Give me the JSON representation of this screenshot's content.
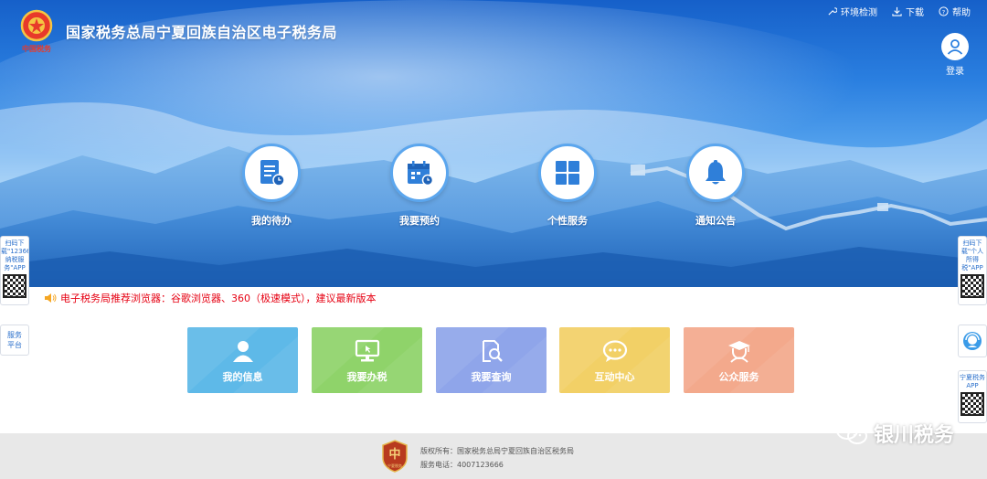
{
  "header": {
    "site_title": "国家税务总局宁夏回族自治区电子税务局",
    "logo_text": "中国税务",
    "top_links": [
      {
        "label": "环境检测",
        "icon": "wrench-icon"
      },
      {
        "label": "下载",
        "icon": "download-icon"
      },
      {
        "label": "帮助",
        "icon": "help-icon"
      }
    ],
    "login_label": "登录"
  },
  "hero_tiles": [
    {
      "label": "我的待办",
      "icon": "todo-list-icon"
    },
    {
      "label": "我要预约",
      "icon": "calendar-icon"
    },
    {
      "label": "个性服务",
      "icon": "grid-icon"
    },
    {
      "label": "通知公告",
      "icon": "bell-icon"
    }
  ],
  "notice": {
    "text": "电子税务局推荐浏览器：谷歌浏览器、360（极速模式），建议最新版本",
    "icon": "speaker-icon",
    "color": "#e60012"
  },
  "service_cards": [
    {
      "label": "我的信息",
      "icon": "user-icon",
      "color": "#5eb9e8"
    },
    {
      "label": "我要办税",
      "icon": "monitor-icon",
      "color": "#8fd36a"
    },
    {
      "label": "我要查询",
      "icon": "search-doc-icon",
      "color": "#8fa5ea"
    },
    {
      "label": "互动中心",
      "icon": "chat-icon",
      "color": "#f2d066"
    },
    {
      "label": "公众服务",
      "icon": "graduate-icon",
      "color": "#f3a98c"
    }
  ],
  "side_left": [
    {
      "text": "扫码下载\"12366纳税服务\"APP",
      "icon": "qr-code-icon"
    },
    {
      "text": "服务平台",
      "icon": ""
    }
  ],
  "side_right": [
    {
      "text": "扫码下载\"个人所得税\"APP",
      "icon": "qr-code-icon"
    },
    {
      "text": "",
      "icon": "customer-service-icon"
    },
    {
      "text": "宁夏税务APP",
      "icon": "qr-code-icon"
    }
  ],
  "footer": {
    "badge_text": "宁夏税务",
    "copyright": "版权所有：国家税务总局宁夏回族自治区税务局",
    "phone": "服务电话：4007123666"
  },
  "watermark": "银川税务"
}
